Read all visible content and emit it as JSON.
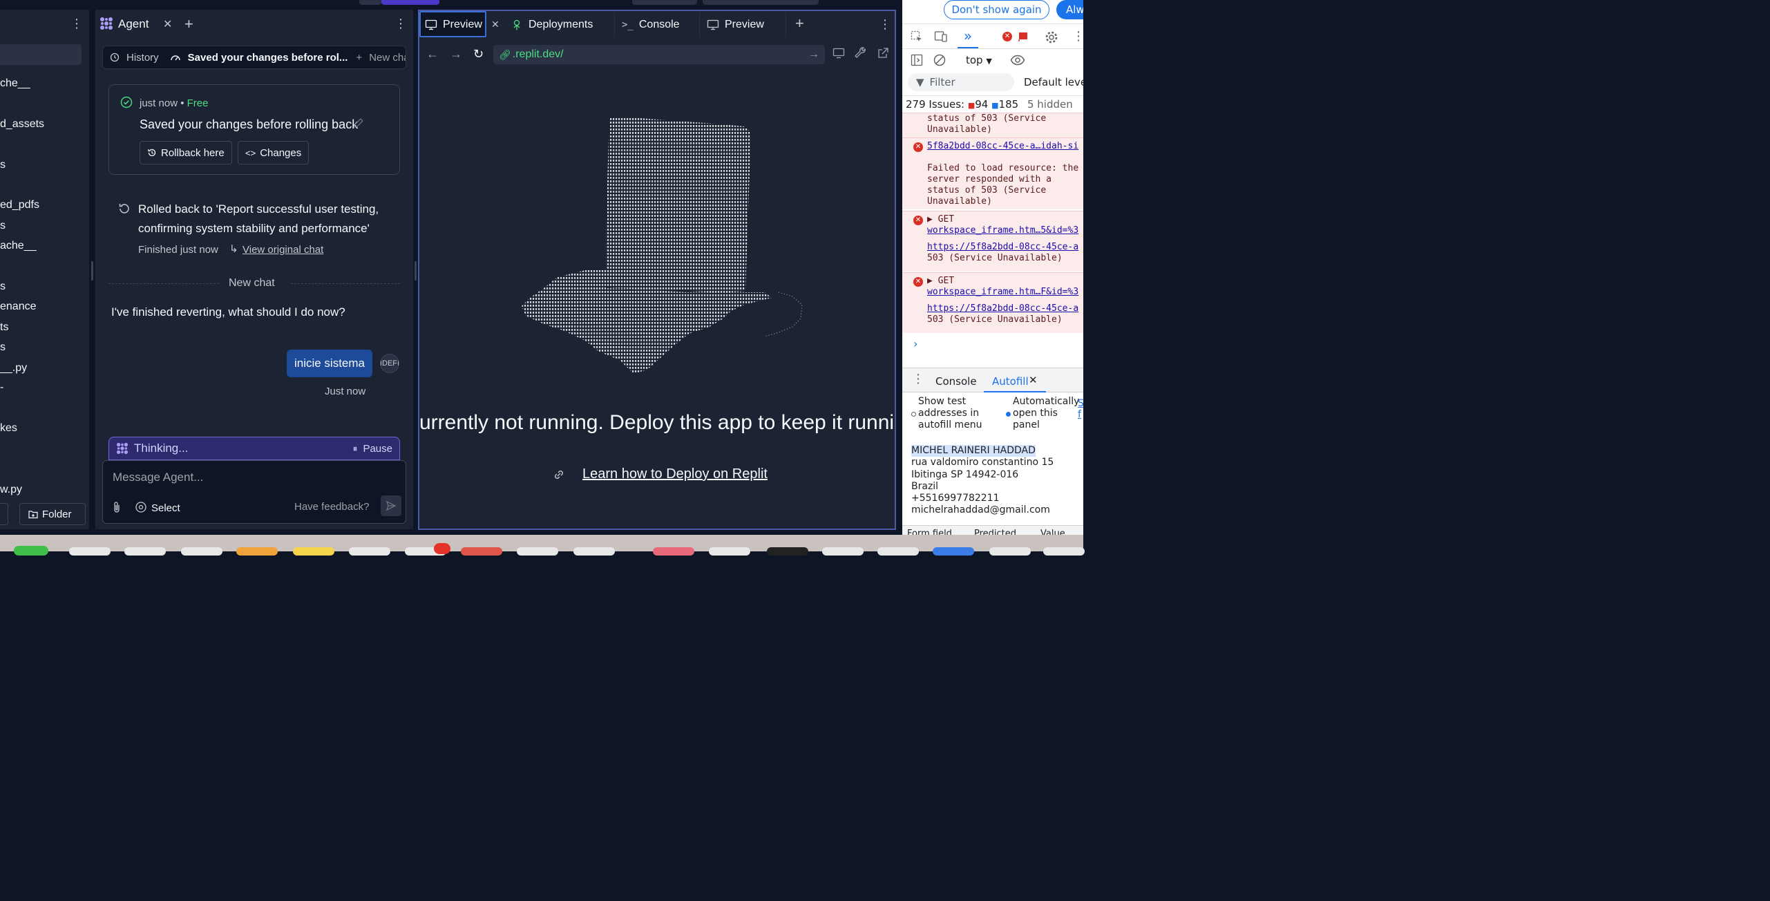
{
  "filetree": {
    "items": [
      "che__",
      "d_assets",
      "s",
      "ed_pdfs",
      "s",
      "ache__",
      "s",
      "enance",
      "ts",
      "s",
      "__.py",
      "-",
      "kes",
      "w.py"
    ],
    "folder_button": "Folder"
  },
  "agent": {
    "tab_title": "Agent",
    "history_label": "History",
    "checkpoint_title": "Saved your changes before rol...",
    "new_chat_label": "New chat",
    "card": {
      "time": "just now",
      "price": "Free",
      "title": "Saved your changes before rolling back",
      "rollback_button": "Rollback here",
      "changes_button": "Changes"
    },
    "rollback": {
      "message": "Rolled back to 'Report successful user testing, confirming system stability and performance'",
      "finished": "Finished just now",
      "view_original": "View original chat"
    },
    "divider_label": "New chat",
    "agent_message": "I've finished reverting, what should I do now?",
    "user_message": "inicie sistema",
    "avatar_text": "IDEFI",
    "user_time": "Just now",
    "thinking_label": "Thinking...",
    "pause_label": "Pause",
    "input_placeholder": "Message Agent...",
    "select_label": "Select",
    "feedback_label": "Have feedback?"
  },
  "preview": {
    "tabs": [
      "Preview",
      "Deployments",
      "Console",
      "Preview"
    ],
    "url": ".replit.dev/",
    "not_running_text": "urrently not running. Deploy this app to keep it runnin",
    "deploy_link": "Learn how to Deploy on Replit"
  },
  "devtools": {
    "dont_show": "Don't show again",
    "always": "Alw",
    "context": "top",
    "filter_placeholder": "Filter",
    "levels": "Default level",
    "issues_label": "279 Issues:",
    "error_count": "94",
    "msg_count": "185",
    "hidden": "5 hidden",
    "errors": [
      {
        "text": "status of 503 (Service Unavailable)"
      },
      {
        "link": "5f8a2bdd-08cc-45ce-a…idah-si",
        "text": "Failed to load resource: the server responded with a status of 503 (Service Unavailable)"
      },
      {
        "method": "GET",
        "link": "workspace_iframe.htm…5&id=%3",
        "url": "https://5f8a2bdd-08cc-45ce-a",
        "text": "503 (Service Unavailable)"
      },
      {
        "method": "GET",
        "link": "workspace_iframe.htm…F&id=%3",
        "url": "https://5f8a2bdd-08cc-45ce-a",
        "text": "503 (Service Unavailable)"
      }
    ],
    "drawer_tabs": [
      "Console",
      "Autofill"
    ],
    "autofill": {
      "show_test": "Show test addresses in autofill menu",
      "auto_open": "Automatically open this panel",
      "name": "MICHEL RAINERI HADDAD",
      "street": "rua valdomiro constantino 15",
      "city": "Ibitinga SP 14942-016",
      "country": "Brazil",
      "phone": "+5516997782211",
      "email": "michelrahaddad@gmail.com",
      "columns": [
        "Form field",
        "Predicted",
        "Value"
      ]
    }
  },
  "colors": {
    "bg": "#0e1525",
    "panel": "#1c2333",
    "accent": "#6e6bd4",
    "link_green": "#4ade80"
  }
}
